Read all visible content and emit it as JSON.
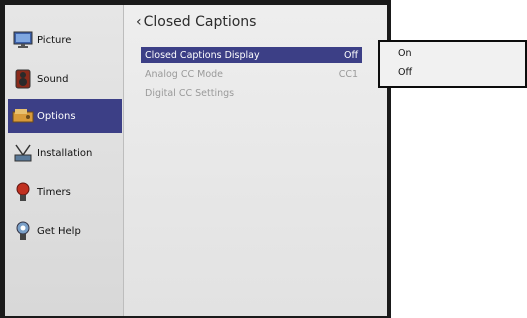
{
  "sidebar": {
    "items": [
      {
        "label": "Picture",
        "icon": "monitor-icon",
        "active": false
      },
      {
        "label": "Sound",
        "icon": "speaker-icon",
        "active": false
      },
      {
        "label": "Options",
        "icon": "options-icon",
        "active": true
      },
      {
        "label": "Installation",
        "icon": "antenna-icon",
        "active": false
      },
      {
        "label": "Timers",
        "icon": "timer-icon",
        "active": false
      },
      {
        "label": "Get Help",
        "icon": "help-icon",
        "active": false
      }
    ]
  },
  "main": {
    "title": "Closed Captions",
    "rows": [
      {
        "label": "Closed Captions Display",
        "value": "Off",
        "state": "selected"
      },
      {
        "label": "Analog CC Mode",
        "value": "CC1",
        "state": "disabled"
      },
      {
        "label": "Digital CC Settings",
        "value": "",
        "state": "disabled"
      }
    ]
  },
  "popup": {
    "options": [
      "On",
      "Off"
    ]
  },
  "colors": {
    "accent": "#3c3f86",
    "frame": "#1a1a1a",
    "panel": "#e6e6e6",
    "disabled_text": "#9a9a9a"
  }
}
